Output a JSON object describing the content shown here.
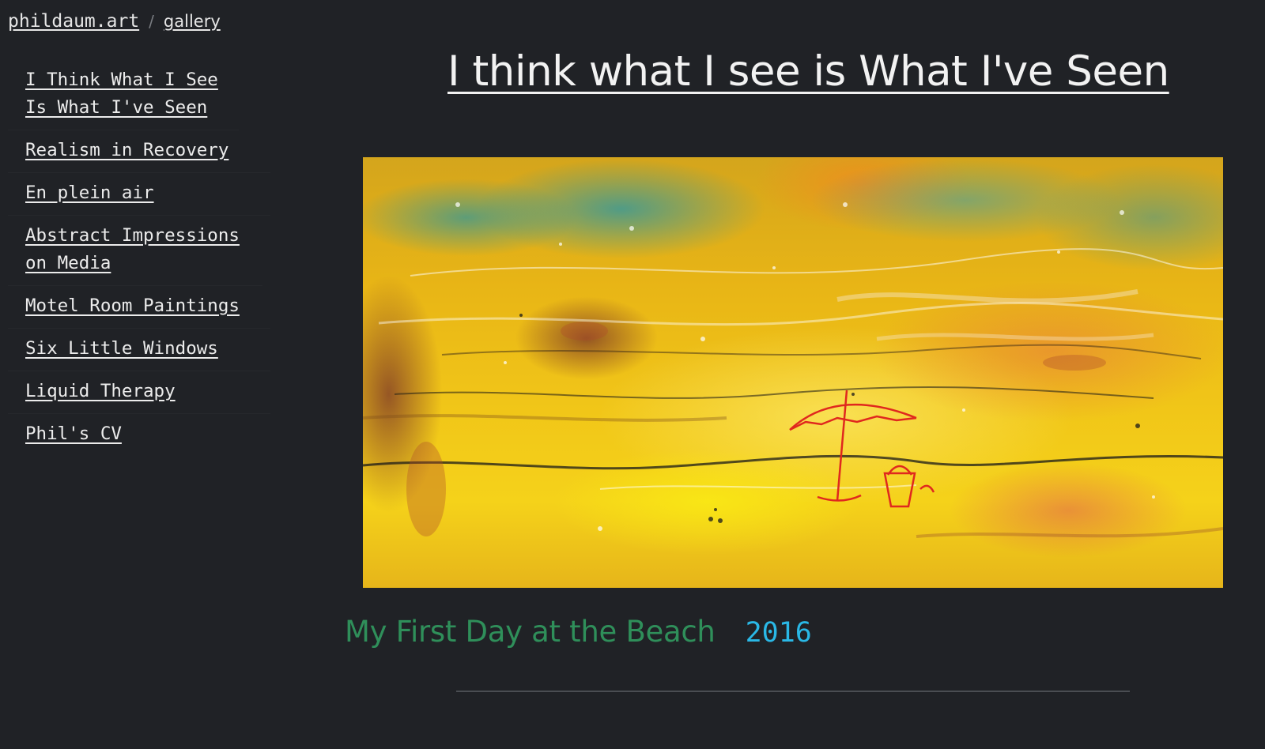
{
  "breadcrumb": {
    "site": "phildaum.art",
    "separator": "/",
    "current": "gallery"
  },
  "sidebar": {
    "items": [
      {
        "label": "I Think What I See Is What I've Seen"
      },
      {
        "label": "Realism in Recovery"
      },
      {
        "label": "En plein air"
      },
      {
        "label": "Abstract Impressions on Media"
      },
      {
        "label": "Motel Room Paintings"
      },
      {
        "label": "Six Little Windows"
      },
      {
        "label": "Liquid Therapy"
      },
      {
        "label": "Phil's CV"
      }
    ]
  },
  "main": {
    "title": "I think what I see is What I've Seen",
    "artwork": {
      "title": "My First Day at the Beach",
      "year": "2016"
    }
  },
  "colors": {
    "background": "#202226",
    "caption_title": "#2f8f5a",
    "caption_year": "#2ab8e6"
  }
}
